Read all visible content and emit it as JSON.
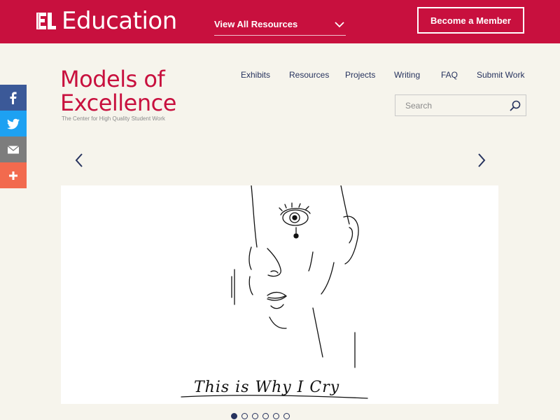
{
  "topbar": {
    "logo_text": "EL",
    "brand": "Education",
    "resources_label": "View All Resources",
    "member_button": "Become a Member"
  },
  "site": {
    "title_line1": "Models of",
    "title_line2": "Excellence",
    "tagline": "The Center for High Quality Student Work"
  },
  "nav": [
    "Exhibits",
    "Resources",
    "Projects",
    "Writing",
    "FAQ",
    "Submit Work"
  ],
  "search": {
    "placeholder": "Search"
  },
  "share": [
    {
      "icon": "facebook-icon",
      "color": "#3b5998"
    },
    {
      "icon": "twitter-icon",
      "color": "#1da1f2"
    },
    {
      "icon": "email-icon",
      "color": "#7d7d7d"
    },
    {
      "icon": "plus-icon",
      "color": "#f26a4e"
    }
  ],
  "carousel": {
    "caption": "This is Why I Cry",
    "slide_count": 6,
    "active_index": 0
  },
  "colors": {
    "brand_red": "#c8103e",
    "nav_navy": "#27335e",
    "page_bg": "#f6f4ec"
  }
}
